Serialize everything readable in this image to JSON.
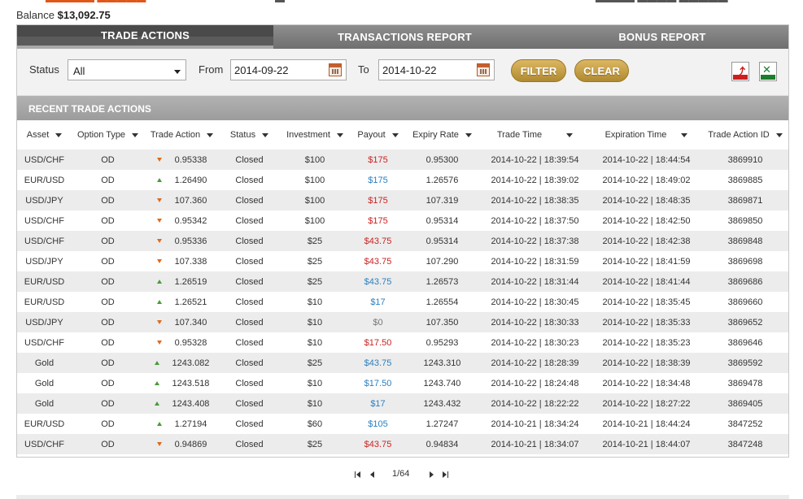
{
  "balance": {
    "label": "Balance",
    "value": "$13,092.75"
  },
  "tabs": [
    {
      "label": "TRADE ACTIONS",
      "active": true
    },
    {
      "label": "TRANSACTIONS REPORT",
      "active": false
    },
    {
      "label": "BONUS REPORT",
      "active": false
    }
  ],
  "filters": {
    "status_label": "Status",
    "status_value": "All",
    "from_label": "From",
    "from_value": "2014-09-22",
    "to_label": "To",
    "to_value": "2014-10-22",
    "filter_button": "FILTER",
    "clear_button": "CLEAR",
    "pdf_icon": "pdf-export-icon",
    "xls_icon": "xls-export-icon"
  },
  "section_title": "RECENT TRADE ACTIONS",
  "columns": [
    "Asset",
    "Option Type",
    "Trade Action",
    "Status",
    "Investment",
    "Payout",
    "Expiry Rate",
    "Trade Time",
    "Expiration Time",
    "Trade Action ID"
  ],
  "rows": [
    {
      "asset": "USD/CHF",
      "option_type": "OD",
      "direction": "down",
      "trade_action": "0.95338",
      "status": "Closed",
      "investment": "$100",
      "payout": "$175",
      "payout_color": "red",
      "expiry_rate": "0.95300",
      "trade_time": "2014-10-22 | 18:39:54",
      "expiration_time": "2014-10-22 | 18:44:54",
      "id": "3869910"
    },
    {
      "asset": "EUR/USD",
      "option_type": "OD",
      "direction": "up",
      "trade_action": "1.26490",
      "status": "Closed",
      "investment": "$100",
      "payout": "$175",
      "payout_color": "blue",
      "expiry_rate": "1.26576",
      "trade_time": "2014-10-22 | 18:39:02",
      "expiration_time": "2014-10-22 | 18:49:02",
      "id": "3869885"
    },
    {
      "asset": "USD/JPY",
      "option_type": "OD",
      "direction": "down",
      "trade_action": "107.360",
      "status": "Closed",
      "investment": "$100",
      "payout": "$175",
      "payout_color": "red",
      "expiry_rate": "107.319",
      "trade_time": "2014-10-22 | 18:38:35",
      "expiration_time": "2014-10-22 | 18:48:35",
      "id": "3869871"
    },
    {
      "asset": "USD/CHF",
      "option_type": "OD",
      "direction": "down",
      "trade_action": "0.95342",
      "status": "Closed",
      "investment": "$100",
      "payout": "$175",
      "payout_color": "red",
      "expiry_rate": "0.95314",
      "trade_time": "2014-10-22 | 18:37:50",
      "expiration_time": "2014-10-22 | 18:42:50",
      "id": "3869850"
    },
    {
      "asset": "USD/CHF",
      "option_type": "OD",
      "direction": "down",
      "trade_action": "0.95336",
      "status": "Closed",
      "investment": "$25",
      "payout": "$43.75",
      "payout_color": "red",
      "expiry_rate": "0.95314",
      "trade_time": "2014-10-22 | 18:37:38",
      "expiration_time": "2014-10-22 | 18:42:38",
      "id": "3869848"
    },
    {
      "asset": "USD/JPY",
      "option_type": "OD",
      "direction": "down",
      "trade_action": "107.338",
      "status": "Closed",
      "investment": "$25",
      "payout": "$43.75",
      "payout_color": "red",
      "expiry_rate": "107.290",
      "trade_time": "2014-10-22 | 18:31:59",
      "expiration_time": "2014-10-22 | 18:41:59",
      "id": "3869698"
    },
    {
      "asset": "EUR/USD",
      "option_type": "OD",
      "direction": "up",
      "trade_action": "1.26519",
      "status": "Closed",
      "investment": "$25",
      "payout": "$43.75",
      "payout_color": "blue",
      "expiry_rate": "1.26573",
      "trade_time": "2014-10-22 | 18:31:44",
      "expiration_time": "2014-10-22 | 18:41:44",
      "id": "3869686"
    },
    {
      "asset": "EUR/USD",
      "option_type": "OD",
      "direction": "up",
      "trade_action": "1.26521",
      "status": "Closed",
      "investment": "$10",
      "payout": "$17",
      "payout_color": "blue",
      "expiry_rate": "1.26554",
      "trade_time": "2014-10-22 | 18:30:45",
      "expiration_time": "2014-10-22 | 18:35:45",
      "id": "3869660"
    },
    {
      "asset": "USD/JPY",
      "option_type": "OD",
      "direction": "down",
      "trade_action": "107.340",
      "status": "Closed",
      "investment": "$10",
      "payout": "$0",
      "payout_color": "gray",
      "expiry_rate": "107.350",
      "trade_time": "2014-10-22 | 18:30:33",
      "expiration_time": "2014-10-22 | 18:35:33",
      "id": "3869652"
    },
    {
      "asset": "USD/CHF",
      "option_type": "OD",
      "direction": "down",
      "trade_action": "0.95328",
      "status": "Closed",
      "investment": "$10",
      "payout": "$17.50",
      "payout_color": "red",
      "expiry_rate": "0.95293",
      "trade_time": "2014-10-22 | 18:30:23",
      "expiration_time": "2014-10-22 | 18:35:23",
      "id": "3869646"
    },
    {
      "asset": "Gold",
      "option_type": "OD",
      "direction": "up",
      "trade_action": "1243.082",
      "status": "Closed",
      "investment": "$25",
      "payout": "$43.75",
      "payout_color": "blue",
      "expiry_rate": "1243.310",
      "trade_time": "2014-10-22 | 18:28:39",
      "expiration_time": "2014-10-22 | 18:38:39",
      "id": "3869592"
    },
    {
      "asset": "Gold",
      "option_type": "OD",
      "direction": "up",
      "trade_action": "1243.518",
      "status": "Closed",
      "investment": "$10",
      "payout": "$17.50",
      "payout_color": "blue",
      "expiry_rate": "1243.740",
      "trade_time": "2014-10-22 | 18:24:48",
      "expiration_time": "2014-10-22 | 18:34:48",
      "id": "3869478"
    },
    {
      "asset": "Gold",
      "option_type": "OD",
      "direction": "up",
      "trade_action": "1243.408",
      "status": "Closed",
      "investment": "$10",
      "payout": "$17",
      "payout_color": "blue",
      "expiry_rate": "1243.432",
      "trade_time": "2014-10-22 | 18:22:22",
      "expiration_time": "2014-10-22 | 18:27:22",
      "id": "3869405"
    },
    {
      "asset": "EUR/USD",
      "option_type": "OD",
      "direction": "up",
      "trade_action": "1.27194",
      "status": "Closed",
      "investment": "$60",
      "payout": "$105",
      "payout_color": "blue",
      "expiry_rate": "1.27247",
      "trade_time": "2014-10-21 | 18:34:24",
      "expiration_time": "2014-10-21 | 18:44:24",
      "id": "3847252"
    },
    {
      "asset": "USD/CHF",
      "option_type": "OD",
      "direction": "down",
      "trade_action": "0.94869",
      "status": "Closed",
      "investment": "$25",
      "payout": "$43.75",
      "payout_color": "red",
      "expiry_rate": "0.94834",
      "trade_time": "2014-10-21 | 18:34:07",
      "expiration_time": "2014-10-21 | 18:44:07",
      "id": "3847248"
    }
  ],
  "pagination": {
    "text": "1/64"
  },
  "colors": {
    "payout_red": "#cc2222",
    "payout_blue": "#2a7fc0",
    "payout_gray": "#777777",
    "arrow_down": "#e06a1a",
    "arrow_up": "#4a9a3a",
    "button_gold": "#c9a24a"
  }
}
